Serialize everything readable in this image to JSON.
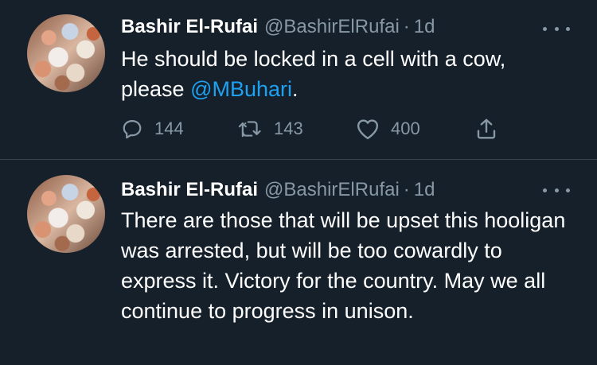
{
  "tweets": [
    {
      "author_name": "Bashir El-Rufai",
      "handle": "@BashirElRufai",
      "separator": "·",
      "time": "1d",
      "text_before": "He should be locked in a cell with a cow, please ",
      "mention": "@MBuhari",
      "text_after": ".",
      "replies": "144",
      "retweets": "143",
      "likes": "400"
    },
    {
      "author_name": "Bashir El-Rufai",
      "handle": "@BashirElRufai",
      "separator": "·",
      "time": "1d",
      "text": "There are those that will be upset this hooligan was arrested, but will be too cowardly to express it. Victory for the country. May we all continue to progress in unison."
    }
  ],
  "icons": [
    "reply-icon",
    "retweet-icon",
    "like-icon",
    "share-icon",
    "more-icon"
  ],
  "colors": {
    "background": "#15202b",
    "text": "#ffffff",
    "secondary": "#8899a6",
    "link": "#1da1f2",
    "divider": "#38444d"
  }
}
